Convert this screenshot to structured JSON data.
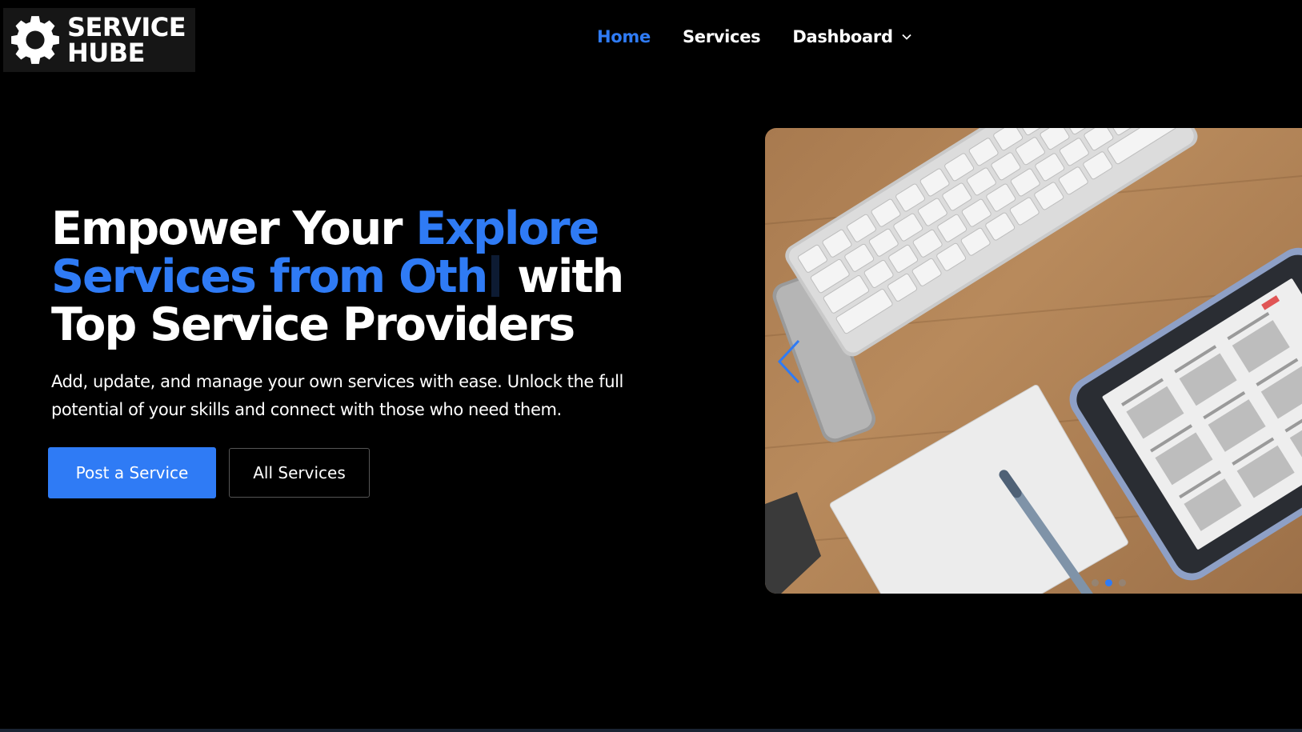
{
  "brand": {
    "line1": "SERVICE",
    "line2": "HUBE",
    "logo_icon": "gear-icon"
  },
  "nav": {
    "home": "Home",
    "services": "Services",
    "dashboard": "Dashboard",
    "dashboard_icon": "chevron-down-icon"
  },
  "hero": {
    "title_part1": "Empower Your ",
    "title_typed": "Explore Services from Oth",
    "title_part2": " with",
    "title_line3": "Top Service Providers",
    "subtitle": "Add, update, and manage your own services with ease. Unlock the full potential of your skills and connect with those who need them.",
    "primary_button": "Post a Service",
    "secondary_button": "All Services"
  },
  "carousel": {
    "active_slide": 2,
    "slide_count": 3,
    "prev_icon": "chevron-left-icon"
  },
  "colors": {
    "accent": "#2f7bf5",
    "background": "#000000"
  }
}
